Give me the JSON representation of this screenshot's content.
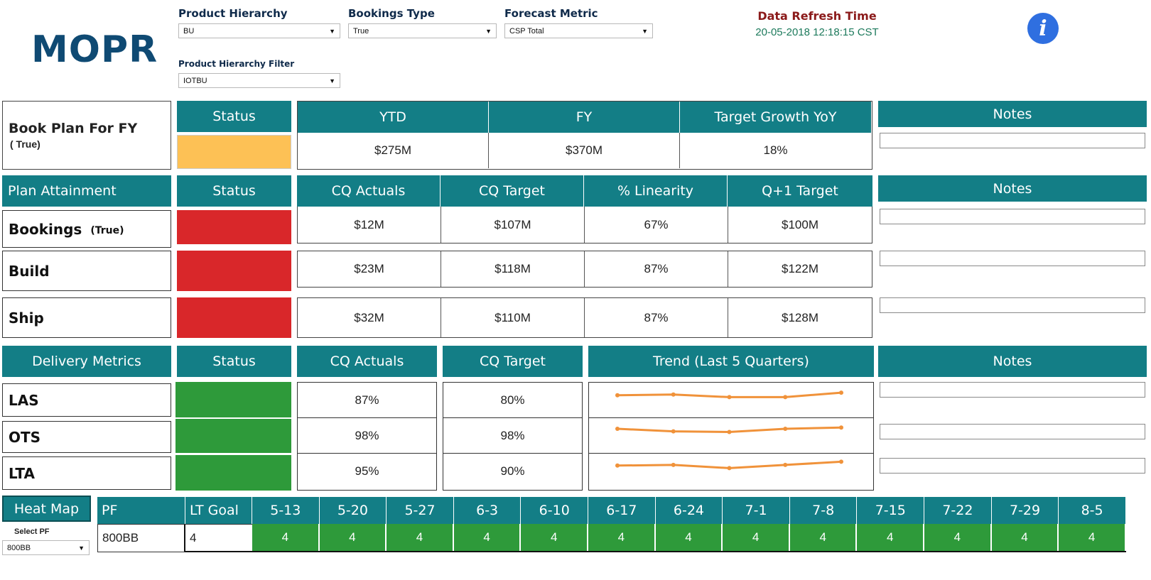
{
  "app": {
    "logo": "MOPR"
  },
  "filters": {
    "product_hierarchy": {
      "label": "Product Hierarchy",
      "value": "BU"
    },
    "bookings_type": {
      "label": "Bookings Type",
      "value": "True"
    },
    "forecast_metric": {
      "label": "Forecast Metric",
      "value": "CSP Total"
    },
    "product_hierarchy_filter": {
      "label": "Product Hierarchy Filter",
      "value": "IOTBU"
    }
  },
  "refresh": {
    "label": "Data Refresh Time",
    "value": "20-05-2018 12:18:15 CST"
  },
  "info_icon": "info-icon",
  "book_plan": {
    "title": "Book Plan For FY",
    "subtitle": "( True)",
    "status_header": "Status",
    "status_color": "#fdc155",
    "headers": [
      "YTD",
      "FY",
      "Target Growth YoY"
    ],
    "values": [
      "$275M",
      "$370M",
      "18%"
    ],
    "notes_header": "Notes"
  },
  "plan_attainment": {
    "title": "Plan Attainment",
    "status_header": "Status",
    "headers": [
      "CQ Actuals",
      "CQ Target",
      "% Linearity",
      "Q+1 Target"
    ],
    "notes_header": "Notes",
    "rows": [
      {
        "label": "Bookings",
        "sub": "(True)",
        "status_color": "#d9272a",
        "values": [
          "$12M",
          "$107M",
          "67%",
          "$100M"
        ]
      },
      {
        "label": "Build",
        "sub": "",
        "status_color": "#d9272a",
        "values": [
          "$23M",
          "$118M",
          "87%",
          "$122M"
        ]
      },
      {
        "label": "Ship",
        "sub": "",
        "status_color": "#d9272a",
        "values": [
          "$32M",
          "$110M",
          "87%",
          "$128M"
        ]
      }
    ]
  },
  "delivery": {
    "title": "Delivery Metrics",
    "status_header": "Status",
    "headers": [
      "CQ Actuals",
      "CQ Target",
      "Trend (Last 5 Quarters)"
    ],
    "notes_header": "Notes",
    "trend_color": "#f0923a",
    "rows": [
      {
        "label": "LAS",
        "status_color": "#2e9a3a",
        "actual": "87%",
        "target": "80%",
        "trend": [
          87,
          88,
          84,
          84,
          91
        ]
      },
      {
        "label": "OTS",
        "status_color": "#2e9a3a",
        "actual": "98%",
        "target": "98%",
        "trend": [
          90,
          86,
          85,
          90,
          92
        ]
      },
      {
        "label": "LTA",
        "status_color": "#2e9a3a",
        "actual": "95%",
        "target": "90%",
        "trend": [
          88,
          89,
          84,
          89,
          94
        ]
      }
    ]
  },
  "heatmap": {
    "title": "Heat Map",
    "select_label": "Select PF",
    "select_value": "800BB",
    "pf_header": "PF",
    "lt_header": "LT Goal",
    "pf_value": "800BB",
    "lt_value": "4",
    "weeks": [
      "5-13",
      "5-20",
      "5-27",
      "6-3",
      "6-10",
      "6-17",
      "6-24",
      "7-1",
      "7-8",
      "7-15",
      "7-22",
      "7-29",
      "8-5"
    ],
    "values": [
      "4",
      "4",
      "4",
      "4",
      "4",
      "4",
      "4",
      "4",
      "4",
      "4",
      "4",
      "4",
      "4"
    ],
    "cell_color": "#2e9a3a"
  }
}
